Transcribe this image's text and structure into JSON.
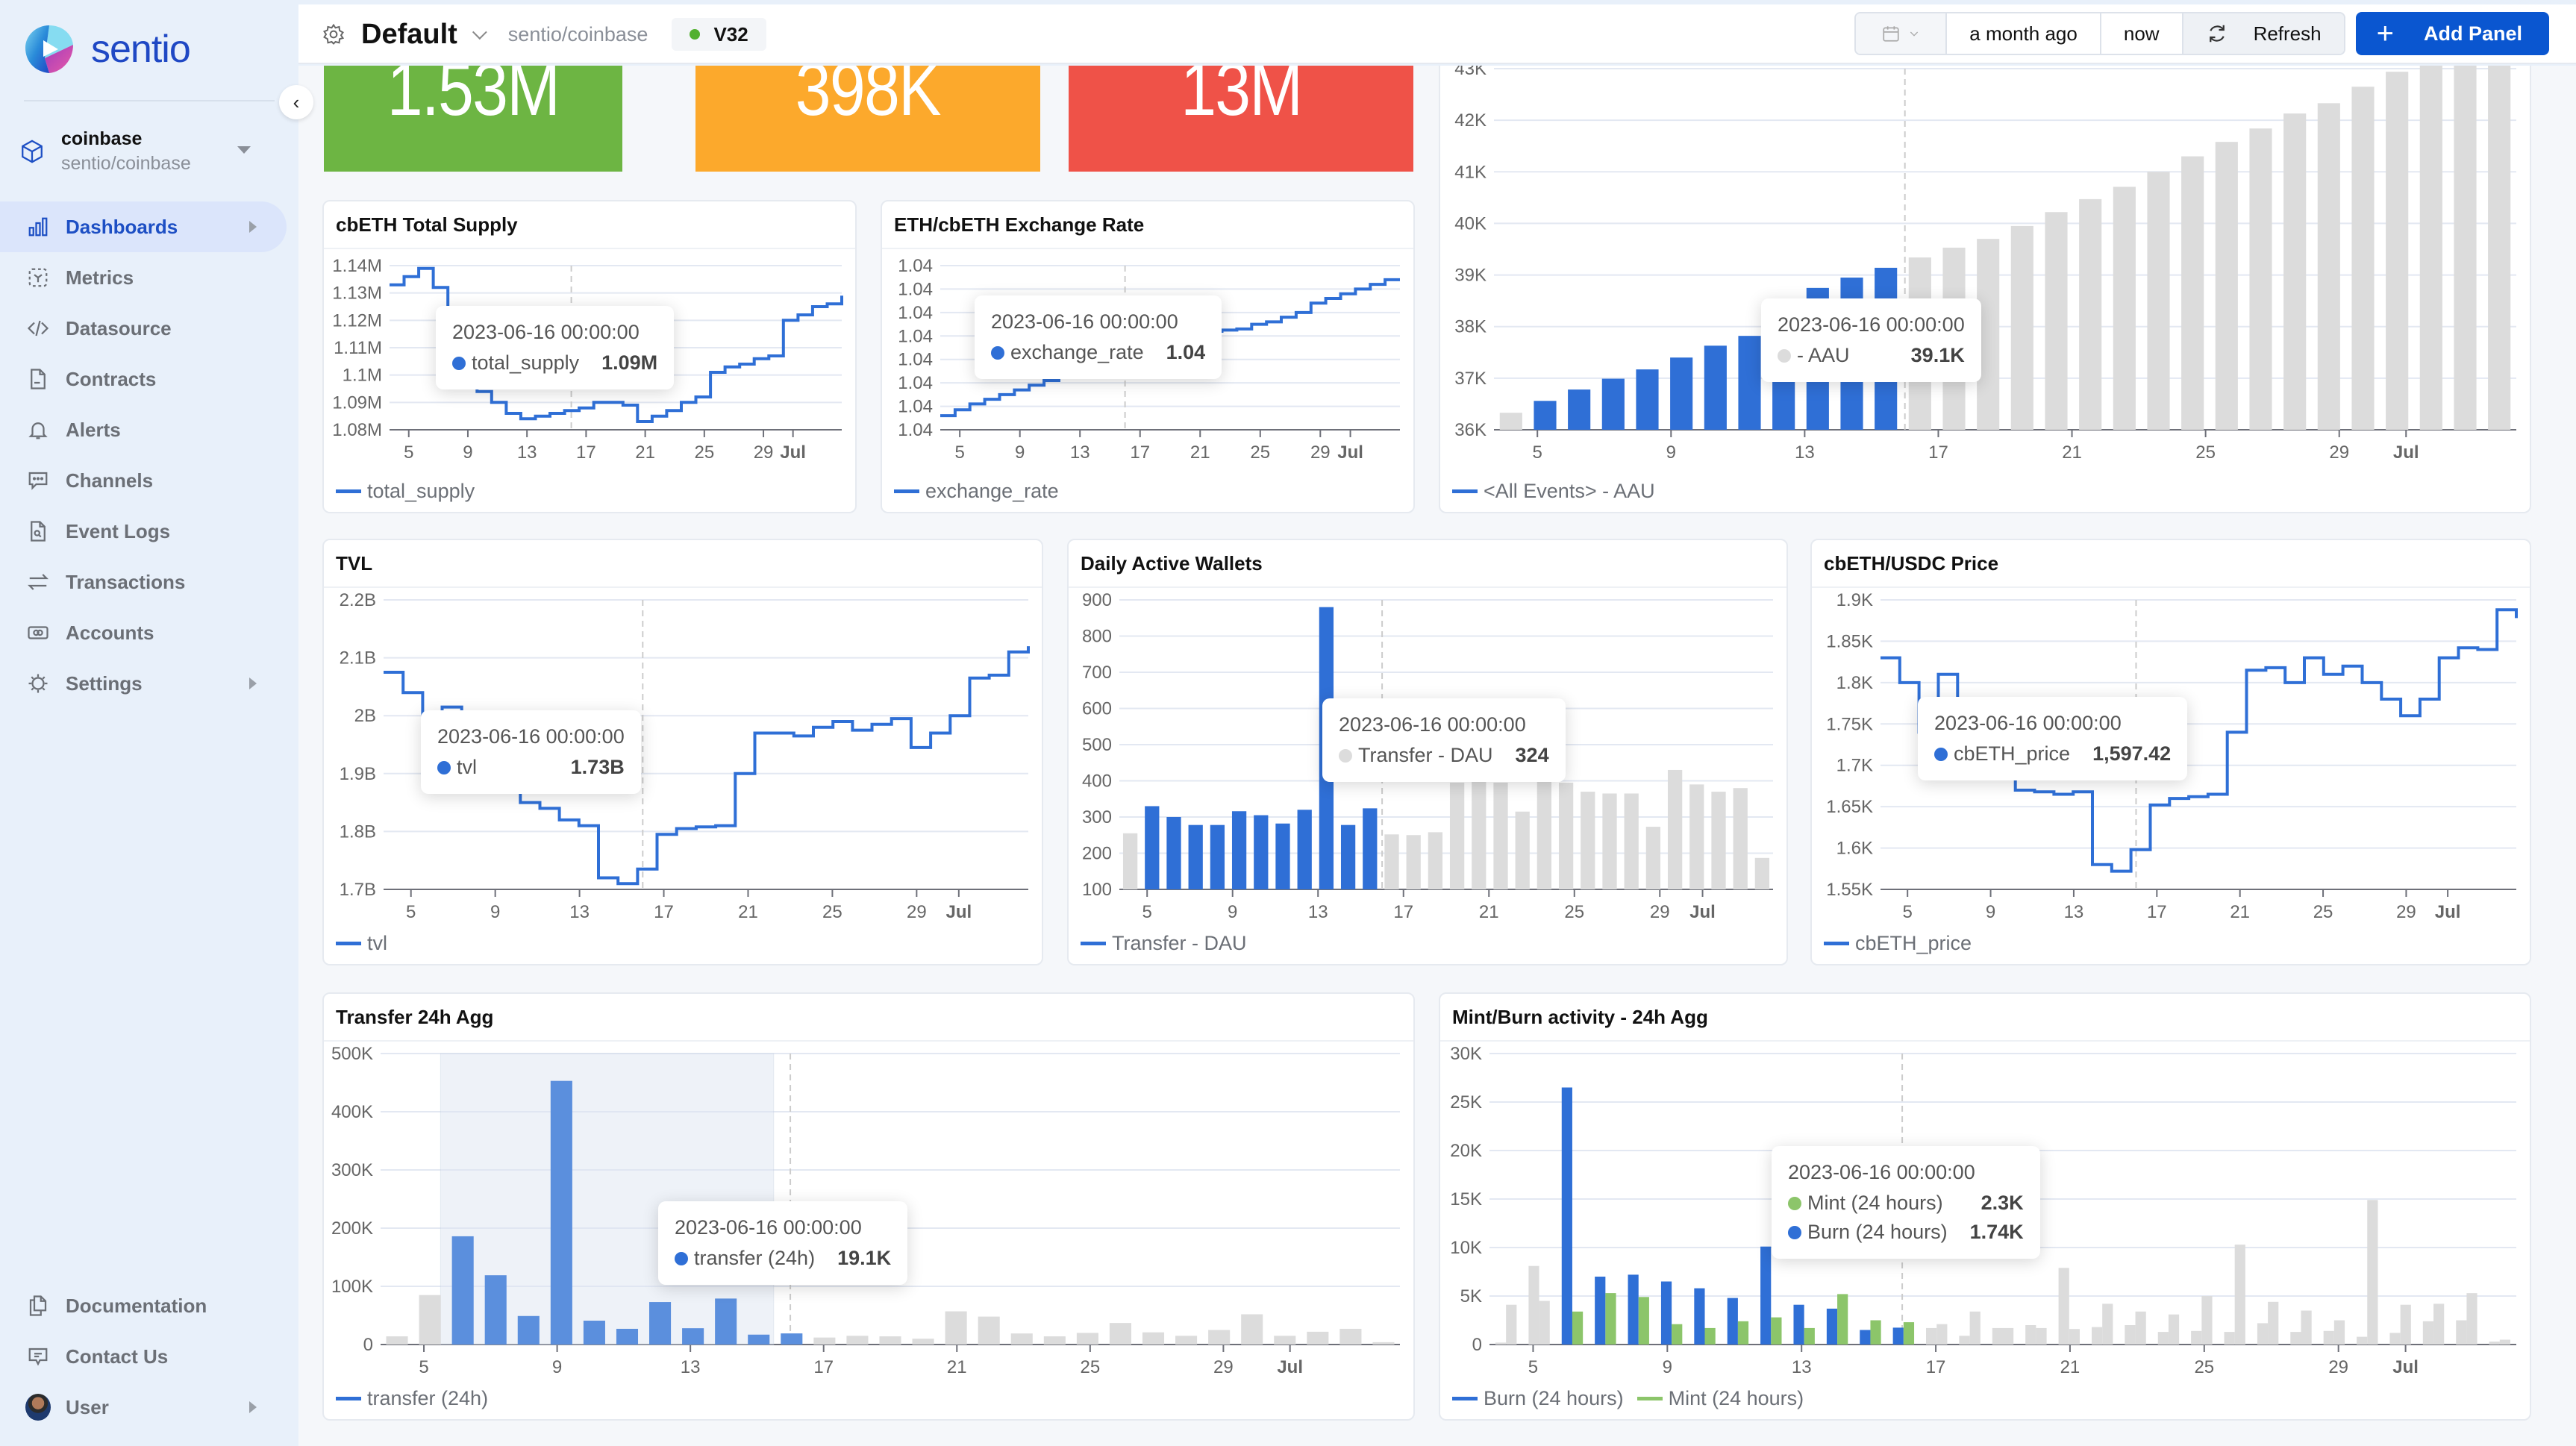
{
  "sidebar": {
    "brand": "sentio",
    "project": {
      "name": "coinbase",
      "path": "sentio/coinbase"
    },
    "items": [
      {
        "label": "Dashboards",
        "icon": "bar-chart-icon",
        "active": true,
        "has_arrow": true
      },
      {
        "label": "Metrics",
        "icon": "metrics-icon",
        "active": false,
        "has_arrow": false
      },
      {
        "label": "Datasource",
        "icon": "code-icon",
        "active": false,
        "has_arrow": false
      },
      {
        "label": "Contracts",
        "icon": "document-icon",
        "active": false,
        "has_arrow": false
      },
      {
        "label": "Alerts",
        "icon": "bell-icon",
        "active": false,
        "has_arrow": false
      },
      {
        "label": "Channels",
        "icon": "chat-icon",
        "active": false,
        "has_arrow": false
      },
      {
        "label": "Event Logs",
        "icon": "log-search-icon",
        "active": false,
        "has_arrow": false
      },
      {
        "label": "Transactions",
        "icon": "arrows-swap-icon",
        "active": false,
        "has_arrow": false
      },
      {
        "label": "Accounts",
        "icon": "account-card-icon",
        "active": false,
        "has_arrow": false
      },
      {
        "label": "Settings",
        "icon": "settings-gear-icon",
        "active": false,
        "has_arrow": true
      }
    ],
    "bottom_items": [
      {
        "label": "Documentation",
        "icon": "docs-icon"
      },
      {
        "label": "Contact Us",
        "icon": "message-icon"
      },
      {
        "label": "User",
        "icon": "avatar"
      }
    ]
  },
  "header": {
    "title": "Default",
    "project_path": "sentio/coinbase",
    "version": "V32",
    "version_status_color": "#52b02e",
    "range_from": "a month ago",
    "range_to": "now",
    "refresh_label": "Refresh",
    "add_panel_label": "Add Panel"
  },
  "stats": [
    {
      "value": "1.53M",
      "color": "#6db543"
    },
    {
      "value": "398K",
      "color": "#fca92c"
    },
    {
      "value": "13M",
      "color": "#ef5248"
    }
  ],
  "colors": {
    "series_blue": "#2f6fd6",
    "series_green": "#8cc56a",
    "inactive_gray": "#dcdcdc",
    "grid": "#e3e8f2"
  },
  "x_ticks": [
    "5",
    "9",
    "13",
    "17",
    "21",
    "25",
    "29",
    "Jul"
  ],
  "tooltip_time": "2023-06-16 00:00:00",
  "chart_data": [
    {
      "id": "total_supply",
      "type": "line",
      "title": "cbETH Total Supply",
      "yticks": [
        "1.08M",
        "1.09M",
        "1.1M",
        "1.11M",
        "1.12M",
        "1.13M",
        "1.14M"
      ],
      "ylim": [
        1080000,
        1140000
      ],
      "legend": [
        "total_supply"
      ],
      "tooltip": {
        "time": "2023-06-16 00:00:00",
        "rows": [
          {
            "name": "total_supply",
            "value": "1.09M",
            "color": "#2f6fd6"
          }
        ]
      },
      "series": [
        {
          "name": "total_supply",
          "values": [
            1133000,
            1136000,
            1139000,
            1132000,
            1112000,
            1098000,
            1094000,
            1090000,
            1086000,
            1084000,
            1085000,
            1086000,
            1087000,
            1088000,
            1090000,
            1090000,
            1089000,
            1083000,
            1085000,
            1087000,
            1090000,
            1092000,
            1101000,
            1103000,
            1104000,
            1106000,
            1107000,
            1120000,
            1122000,
            1125000,
            1126000,
            1129000
          ]
        }
      ]
    },
    {
      "id": "exchange_rate",
      "type": "line",
      "title": "ETH/cbETH Exchange Rate",
      "yticks": [
        "1.04",
        "1.04",
        "1.04",
        "1.04",
        "1.04",
        "1.04",
        "1.04",
        "1.04"
      ],
      "ylim": [
        0,
        7
      ],
      "legend": [
        "exchange_rate"
      ],
      "tooltip": {
        "time": "2023-06-16 00:00:00",
        "rows": [
          {
            "name": "exchange_rate",
            "value": "1.04",
            "color": "#2f6fd6"
          }
        ]
      },
      "series": [
        {
          "name": "exchange_rate",
          "values": [
            0.6,
            0.85,
            1.1,
            1.3,
            1.5,
            1.7,
            1.9,
            2.1,
            2.3,
            2.5,
            2.7,
            2.9,
            3.1,
            3.3,
            3.5,
            3.7,
            3.9,
            4.1,
            4.2,
            4.25,
            4.3,
            4.5,
            4.6,
            4.8,
            5.0,
            5.4,
            5.6,
            5.8,
            6.0,
            6.2,
            6.4,
            6.4
          ]
        }
      ]
    },
    {
      "id": "aau",
      "type": "bar",
      "title": "",
      "yticks": [
        "36K",
        "37K",
        "38K",
        "39K",
        "40K",
        "41K",
        "42K",
        "43K"
      ],
      "ylim": [
        36000,
        43000
      ],
      "legend": [
        "<All Events> - AAU"
      ],
      "highlight_range": [
        1,
        11
      ],
      "tooltip": {
        "time": "2023-06-16 00:00:00",
        "rows": [
          {
            "name": "- AAU",
            "value": "39.1K",
            "color": "#dcdcdc"
          }
        ]
      },
      "series": [
        {
          "name": "<All Events> - AAU",
          "values": [
            36330,
            36560,
            36780,
            36990,
            37170,
            37400,
            37630,
            37820,
            38070,
            38750,
            38950,
            39140,
            39340,
            39530,
            39700,
            39950,
            40220,
            40470,
            40710,
            41000,
            41300,
            41580,
            41840,
            42130,
            42330,
            42650,
            42940,
            43210,
            43500,
            43800
          ]
        }
      ]
    },
    {
      "id": "tvl",
      "type": "line",
      "title": "TVL",
      "yticks": [
        "1.7B",
        "1.8B",
        "1.9B",
        "2B",
        "2.1B",
        "2.2B"
      ],
      "ylim": [
        1700000000,
        2200000000
      ],
      "legend": [
        "tvl"
      ],
      "tooltip": {
        "time": "2023-06-16 00:00:00",
        "rows": [
          {
            "name": "tvl",
            "value": "1.73B",
            "color": "#2f6fd6"
          }
        ]
      },
      "series": [
        {
          "name": "tvl",
          "values": [
            2075000000,
            2040000000,
            1980000000,
            2015000000,
            1960000000,
            1920000000,
            1880000000,
            1850000000,
            1840000000,
            1820000000,
            1810000000,
            1720000000,
            1710000000,
            1735000000,
            1795000000,
            1805000000,
            1808000000,
            1810000000,
            1900000000,
            1970000000,
            1970000000,
            1965000000,
            1980000000,
            1990000000,
            1975000000,
            1985000000,
            1995000000,
            1945000000,
            1970000000,
            2000000000,
            2065000000,
            2070000000,
            2110000000,
            2120000000
          ]
        }
      ]
    },
    {
      "id": "dau",
      "type": "bar",
      "title": "Daily Active Wallets",
      "yticks": [
        "100",
        "200",
        "300",
        "400",
        "500",
        "600",
        "700",
        "800",
        "900"
      ],
      "ylim": [
        100,
        900
      ],
      "legend": [
        "Transfer - DAU"
      ],
      "highlight_range": [
        1,
        11
      ],
      "tooltip": {
        "time": "2023-06-16 00:00:00",
        "rows": [
          {
            "name": "Transfer - DAU",
            "value": "324",
            "color": "#dcdcdc"
          }
        ]
      },
      "series": [
        {
          "name": "Transfer - DAU",
          "values": [
            255,
            330,
            300,
            278,
            278,
            316,
            305,
            282,
            320,
            880,
            278,
            324,
            252,
            250,
            258,
            395,
            400,
            395,
            315,
            410,
            395,
            370,
            365,
            365,
            273,
            430,
            390,
            370,
            380,
            187
          ]
        }
      ]
    },
    {
      "id": "price",
      "type": "line",
      "title": "cbETH/USDC Price",
      "yticks": [
        "1.55K",
        "1.6K",
        "1.65K",
        "1.7K",
        "1.75K",
        "1.8K",
        "1.85K",
        "1.9K"
      ],
      "ylim": [
        1550,
        1900
      ],
      "legend": [
        "cbETH_price"
      ],
      "tooltip": {
        "time": "2023-06-16 00:00:00",
        "rows": [
          {
            "name": "cbETH_price",
            "value": "1,597.42",
            "color": "#2f6fd6"
          }
        ]
      },
      "series": [
        {
          "name": "cbETH_price",
          "values": [
            1830,
            1800,
            1740,
            1810,
            1780,
            1720,
            1690,
            1670,
            1668,
            1665,
            1668,
            1580,
            1572,
            1598,
            1652,
            1660,
            1662,
            1665,
            1740,
            1815,
            1818,
            1800,
            1830,
            1810,
            1820,
            1800,
            1780,
            1760,
            1780,
            1830,
            1842,
            1840,
            1888,
            1878
          ]
        }
      ]
    },
    {
      "id": "transfer24h",
      "type": "bar",
      "title": "Transfer 24h Agg",
      "yticks": [
        "0",
        "100K",
        "200K",
        "300K",
        "400K",
        "500K"
      ],
      "ylim": [
        0,
        500000
      ],
      "legend": [
        "transfer (24h)"
      ],
      "highlight_range": [
        2,
        12
      ],
      "tooltip": {
        "time": "2023-06-16 00:00:00",
        "rows": [
          {
            "name": "transfer (24h)",
            "value": "19.1K",
            "color": "#2f6fd6"
          }
        ]
      },
      "series": [
        {
          "name": "transfer (24h)",
          "values": [
            14000,
            85000,
            186000,
            119000,
            49000,
            453000,
            41000,
            27000,
            73000,
            28000,
            79000,
            17000,
            19100,
            12000,
            15000,
            14000,
            10000,
            57000,
            48000,
            19000,
            14000,
            20000,
            37000,
            21000,
            15000,
            25000,
            52000,
            15000,
            22000,
            27000,
            4000
          ]
        }
      ]
    },
    {
      "id": "mintburn",
      "type": "bar",
      "title": "Mint/Burn activity - 24h Agg",
      "yticks": [
        "0",
        "5K",
        "10K",
        "15K",
        "20K",
        "25K",
        "30K"
      ],
      "ylim": [
        0,
        30000
      ],
      "legend": [
        "Burn (24 hours)",
        "Mint (24 hours)"
      ],
      "highlight_range": [
        2,
        12
      ],
      "tooltip": {
        "time": "2023-06-16 00:00:00",
        "rows": [
          {
            "name": "Mint (24 hours)",
            "value": "2.3K",
            "color": "#8cc56a"
          },
          {
            "name": "Burn (24 hours)",
            "value": "1.74K",
            "color": "#2f6fd6"
          }
        ]
      },
      "series": [
        {
          "name": "Burn (24 hours)",
          "values": [
            200,
            8100,
            26500,
            7000,
            7200,
            6500,
            5800,
            4800,
            10100,
            4100,
            3700,
            1500,
            1740,
            1700,
            900,
            1700,
            2000,
            7900,
            1800,
            2000,
            1300,
            1400,
            1300,
            2200,
            1300,
            1400,
            800,
            1200,
            2400,
            2500,
            300
          ]
        },
        {
          "name": "Mint (24 hours)",
          "values": [
            4100,
            4500,
            3400,
            5300,
            4900,
            2100,
            1700,
            2400,
            2800,
            1700,
            5200,
            2500,
            2300,
            2100,
            3400,
            1700,
            1700,
            1600,
            4200,
            3400,
            3100,
            5000,
            10300,
            4400,
            3500,
            2500,
            14900,
            4100,
            4200,
            5300,
            500
          ]
        }
      ]
    }
  ]
}
